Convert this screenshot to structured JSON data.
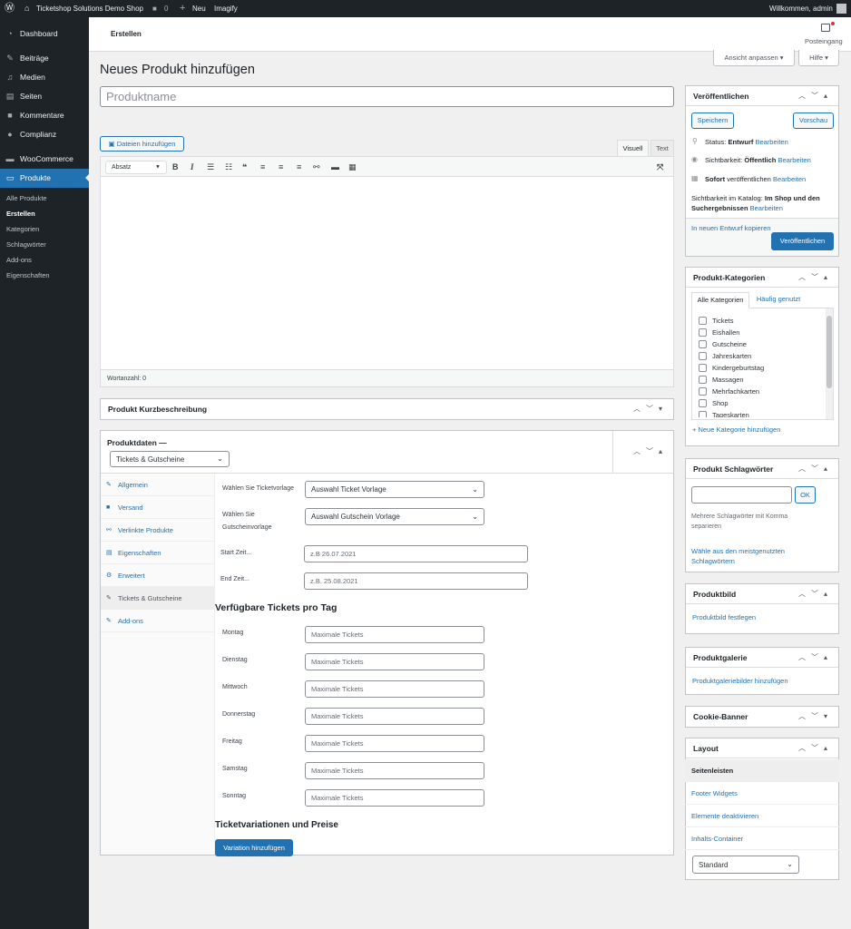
{
  "adminbar": {
    "site_name": "Ticketshop Solutions Demo Shop",
    "comments_count": "0",
    "new_label": "Neu",
    "imagify_label": "Imagify",
    "welcome": "Willkommen, admin"
  },
  "sidebar": {
    "items": [
      {
        "label": "Dashboard",
        "icon": "dashboard-icon"
      },
      {
        "label": "Beiträge",
        "icon": "pin-icon"
      },
      {
        "label": "Medien",
        "icon": "media-icon"
      },
      {
        "label": "Seiten",
        "icon": "pages-icon"
      },
      {
        "label": "Kommentare",
        "icon": "comment-icon"
      },
      {
        "label": "Complianz",
        "icon": "complianz-icon"
      },
      {
        "label": "WooCommerce",
        "icon": "woo-icon"
      },
      {
        "label": "Produkte",
        "icon": "archive-icon"
      }
    ],
    "submenu": [
      "Alle Produkte",
      "Erstellen",
      "Kategorien",
      "Schlagwörter",
      "Add-ons",
      "Eigenschaften"
    ]
  },
  "subbar": {
    "tab": "Erstellen",
    "inbox": "Posteingang"
  },
  "screen": {
    "options": "Ansicht anpassen",
    "help": "Hilfe"
  },
  "page": {
    "title": "Neues Produkt hinzufügen",
    "name_placeholder": "Produktname"
  },
  "editor": {
    "add_media": "Dateien hinzufügen",
    "tab_visual": "Visuell",
    "tab_text": "Text",
    "format": "Absatz",
    "word_count": "Wortanzahl: 0"
  },
  "short_desc": {
    "title": "Produkt Kurzbeschreibung"
  },
  "product_data": {
    "title": "Produktdaten —",
    "type": "Tickets & Gutscheine",
    "tabs": [
      {
        "label": "Allgemein",
        "icon": "wrench-icon"
      },
      {
        "label": "Versand",
        "icon": "truck-icon"
      },
      {
        "label": "Verlinkte Produkte",
        "icon": "link-icon"
      },
      {
        "label": "Eigenschaften",
        "icon": "table-icon"
      },
      {
        "label": "Erweitert",
        "icon": "gear-icon"
      },
      {
        "label": "Tickets & Gutscheine",
        "icon": "wrench-icon"
      },
      {
        "label": "Add-ons",
        "icon": "wrench-icon"
      }
    ],
    "ticket_tpl_label": "Wählen Sie Ticketvorlage",
    "ticket_tpl_value": "Auswahl Ticket Vorlage",
    "voucher_tpl_label_1": "Wählen Sie",
    "voucher_tpl_label_2": "Gutscheinvorlage",
    "voucher_tpl_value": "Auswahl Gutschein Vorlage",
    "start_label": "Start Zeit...",
    "start_placeholder": "z.B 26.07.2021",
    "end_label": "End Zeit...",
    "end_placeholder": "z.B. 25.08.2021",
    "tickets_heading": "Verfügbare Tickets pro Tag",
    "days": [
      "Montag",
      "Dienstag",
      "Mittwoch",
      "Donnerstag",
      "Freitag",
      "Samstag",
      "Sonntag"
    ],
    "day_placeholder": "Maximale Tickets",
    "variations_heading": "Ticketvariationen und Preise",
    "add_variation": "Variation hinzufügen"
  },
  "publish": {
    "title": "Veröffentlichen",
    "save": "Speichern",
    "preview": "Vorschau",
    "status_label": "Status:",
    "status_value": "Entwurf",
    "edit": "Bearbeiten",
    "visibility_label": "Sichtbarkeit:",
    "visibility_value": "Öffentlich",
    "immediately": "Sofort",
    "publish_when": "veröffentlichen",
    "catalog_label": "Sichtbarkeit im Katalog:",
    "catalog_value_1": "Im Shop und den",
    "catalog_value_2": "Suchergebnissen",
    "copy_draft": "In neuen Entwurf kopieren",
    "publish_btn": "Veröffentlichen"
  },
  "categories": {
    "title": "Produkt-Kategorien",
    "tab_all": "Alle Kategorien",
    "tab_popular": "Häufig genutzt",
    "items": [
      "Tickets",
      "Eishallen",
      "Gutscheine",
      "Jahreskarten",
      "Kindergeburtstag",
      "Massagen",
      "Mehrfachkarten",
      "Shop",
      "Tageskarten"
    ],
    "add_new": "+ Neue Kategorie hinzufügen"
  },
  "tags": {
    "title": "Produkt Schlagwörter",
    "ok": "OK",
    "hint_1": "Mehrere Schlagwörter mit Komma",
    "hint_2": "separieren",
    "choose_1": "Wähle aus den meistgenutzten",
    "choose_2": "Schlagwörtern"
  },
  "image": {
    "title": "Produktbild",
    "set": "Produktbild festlegen"
  },
  "gallery": {
    "title": "Produktgalerie",
    "add": "Produktgaleriebilder hinzufügen"
  },
  "cookie": {
    "title": "Cookie-Banner"
  },
  "layout": {
    "title": "Layout",
    "rows": [
      "Seitenleisten",
      "Footer Widgets",
      "Elemente deaktivieren",
      "Inhalts-Container"
    ],
    "select": "Standard"
  },
  "colors": {
    "accent": "#2271b1",
    "adminbar": "#1d2327",
    "bg": "#f0f0f1"
  }
}
